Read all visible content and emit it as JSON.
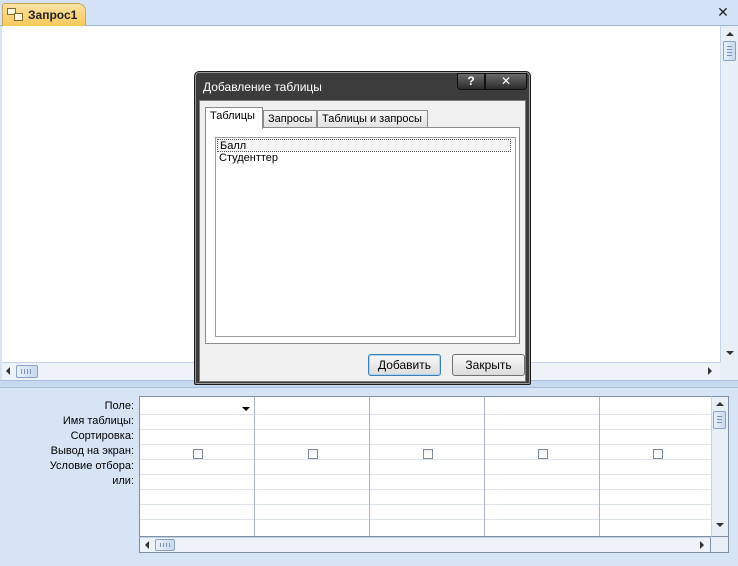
{
  "document": {
    "tab_label": "Запрос1",
    "tab_icon": "query-icon",
    "close_glyph": "✕"
  },
  "qbe_grid": {
    "row_labels": [
      "Поле:",
      "Имя таблицы:",
      "Сортировка:",
      "Вывод на экран:",
      "Условие отбора:",
      "или:"
    ],
    "columns": 5
  },
  "dialog": {
    "title": "Добавление таблицы",
    "help_glyph": "?",
    "close_glyph": "✕",
    "tabs": [
      {
        "label": "Таблицы",
        "active": true
      },
      {
        "label": "Запросы",
        "active": false
      },
      {
        "label": "Таблицы и запросы",
        "active": false
      }
    ],
    "list_items": [
      {
        "label": "Балл",
        "selected": true
      },
      {
        "label": "Студенттер",
        "selected": false
      }
    ],
    "add_button": "Добавить",
    "close_button": "Закрыть"
  },
  "colors": {
    "tab_active": "#f7c85b",
    "background": "#d6e4f5",
    "dialog_frame": "#3c3c3c"
  }
}
